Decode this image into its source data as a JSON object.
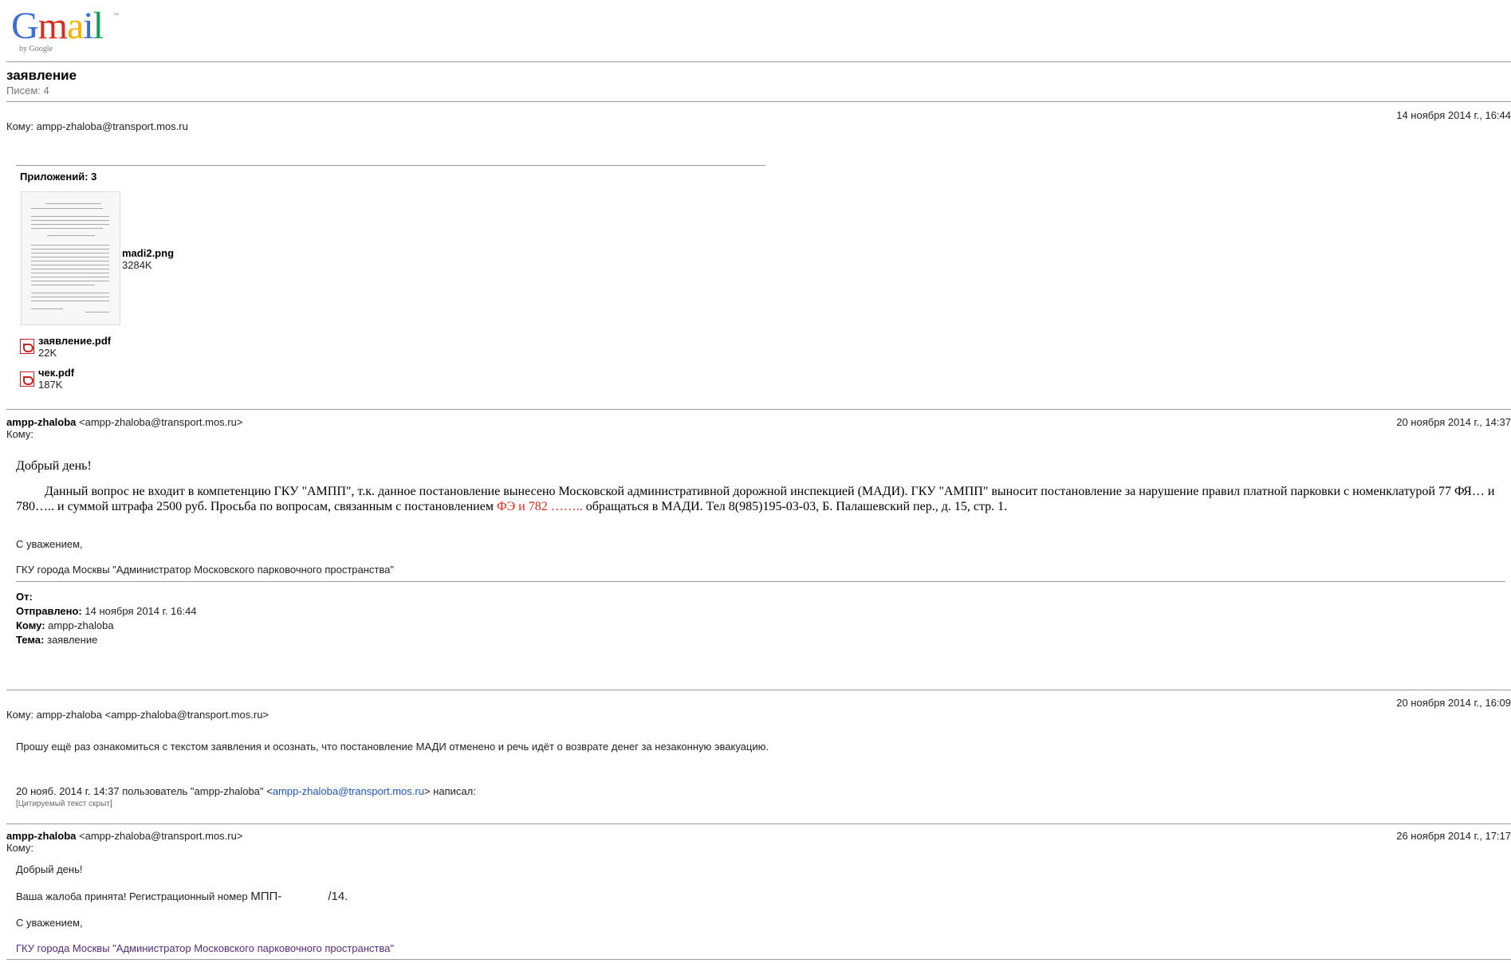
{
  "logo": {
    "word": "Gmail",
    "by": "by Google",
    "tm": "™"
  },
  "thread": {
    "subject": "заявление",
    "count": "Писем: 4"
  },
  "m1": {
    "date": "14 ноября 2014 г., 16:44",
    "to": "Кому: ampp-zhaloba@transport.mos.ru",
    "attach_title": "Приложений: 3",
    "att1_name": "madi2.png",
    "att1_size": "3284K",
    "att2_name": "заявление.pdf",
    "att2_size": "22K",
    "att3_name": "чек.pdf",
    "att3_size": "187K"
  },
  "m2": {
    "from_name": "ampp-zhaloba",
    "from_addr": "<ampp-zhaloba@transport.mos.ru>",
    "to": "Кому:",
    "date": "20 ноября 2014 г., 14:37",
    "greet": "Добрый день!",
    "body_1a": "Данный вопрос не входит в компетенцию ГКУ \"АМПП\", т.к. данное постановление вынесено Московской административной дорожной инспекцией (МАДИ). ГКУ \"АМПП\" выносит постановление за нарушение правил платной парковки с номенклатурой 77 ФЯ… и",
    "body_2a": "780….. и суммой штрафа 2500 руб. Просьба по вопросам, связанным с постановлением ",
    "body_2red": "ФЭ и 782 ……..",
    "body_2b": " обращаться в МАДИ. Тел 8(985)195-03-03, Б. Палашевский пер., д. 15, стр. 1.",
    "regards": "С уважением,",
    "org": "ГКУ города Москвы \"Администратор Московского парковочного пространства\"",
    "q_from": "От:",
    "q_sent_label": "Отправлено:",
    "q_sent": "14 ноября 2014 г. 16:44",
    "q_to_label": "Кому:",
    "q_to": "ampp-zhaloba",
    "q_subj_label": "Тема:",
    "q_subj": "заявление"
  },
  "m3": {
    "date": "20 ноября 2014 г., 16:09",
    "to": "Кому: ampp-zhaloba <ampp-zhaloba@transport.mos.ru>",
    "body": "Прошу ещё раз ознакомиться с текстом заявления и осознать, что постановление МАДИ отменено и речь идёт о возврате денег за незаконную эвакуацию.",
    "quote_a": "20 нояб. 2014 г. 14:37 пользователь \"ampp-zhaloba\" <",
    "quote_link": "ampp-zhaloba@transport.mos.ru",
    "quote_b": "> написал:",
    "hidden": "[Цитируемый текст скрыт]"
  },
  "m4": {
    "from_name": "ampp-zhaloba",
    "from_addr": "<ampp-zhaloba@transport.mos.ru>",
    "to": "Кому:",
    "date": "26 ноября 2014 г., 17:17",
    "greet": "Добрый день!",
    "reg_a": "Ваша жалоба принята! Регистрационный номер ",
    "reg_b": "МПП-",
    "reg_c": "/14.",
    "regards": "С уважением,",
    "org": "ГКУ города Москвы \"Администратор Московского парковочного пространства\""
  }
}
